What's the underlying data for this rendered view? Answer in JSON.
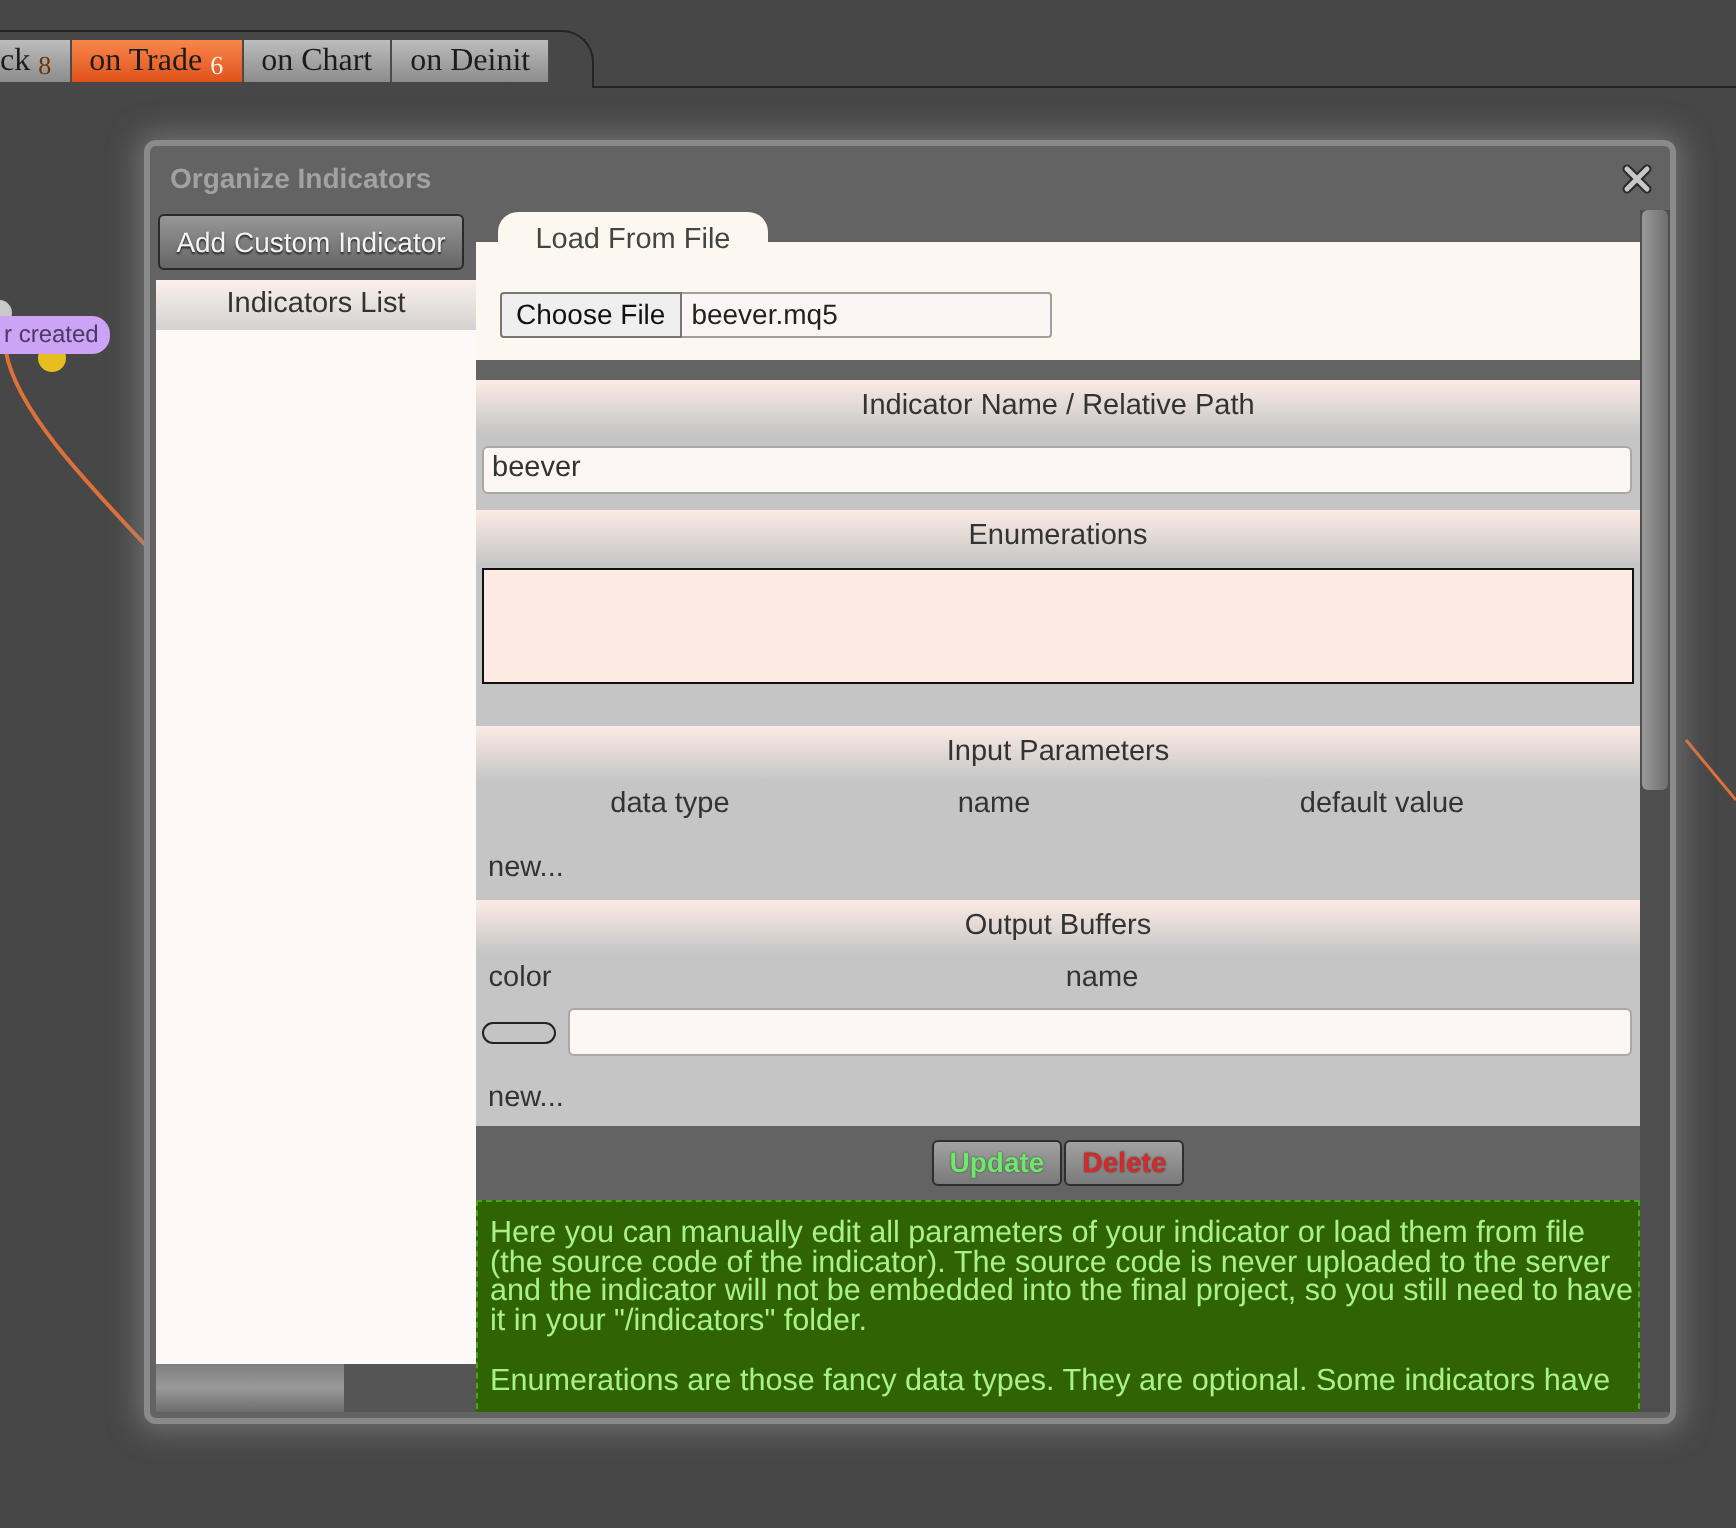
{
  "event_tabs": [
    {
      "label": "ck",
      "count": "8",
      "selected": false
    },
    {
      "label": "on Trade",
      "count": "6",
      "selected": true
    },
    {
      "label": "on Chart",
      "selected": false
    },
    {
      "label": "on Deinit",
      "selected": false
    }
  ],
  "canvas": {
    "node_label": "r created"
  },
  "dialog": {
    "title": "Organize Indicators",
    "add_button": "Add Custom Indicator",
    "indicators_list": {
      "title": "Indicators List"
    },
    "load_tab": {
      "label": "Load From File",
      "choose_button": "Choose File",
      "file_name": "beever.mq5"
    },
    "sections": [
      {
        "kind": "name",
        "title": "Indicator Name / Relative Path",
        "value": "beever"
      },
      {
        "kind": "enumerations",
        "title": "Enumerations"
      },
      {
        "kind": "inputs",
        "title": "Input Parameters",
        "columns": [
          "data type",
          "name",
          "default value"
        ],
        "new_link": "new..."
      },
      {
        "kind": "outputs",
        "title": "Output Buffers",
        "columns": [
          "color",
          "name"
        ],
        "buffers": [
          {
            "color": "#c4c4c4"
          }
        ],
        "new_link": "new..."
      }
    ],
    "actions": [
      {
        "kind": "update",
        "label": "Update"
      },
      {
        "kind": "delete",
        "label": "Delete"
      }
    ],
    "help": [
      "Here you can manually edit all parameters of your indicator or load them from file (the source code of the indicator). The source code is never uploaded to the server and the indicator will not be embedded into the final project, so you still need to have it in your \"/indicators\" folder.",
      "Enumerations are those fancy data types. They are optional. Some indicators have"
    ]
  }
}
